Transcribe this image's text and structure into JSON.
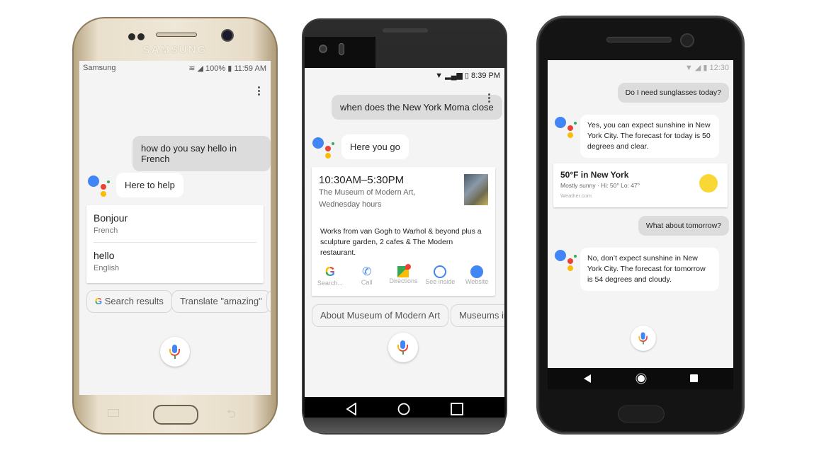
{
  "phones": [
    {
      "brand": "SAMSUNG",
      "status": {
        "carrier": "Samsung",
        "battery": "100%",
        "time": "11:59 AM"
      },
      "user_query": "how do you say hello in French",
      "assistant_reply": "Here to help",
      "translation_card": [
        {
          "word": "Bonjour",
          "language": "French"
        },
        {
          "word": "hello",
          "language": "English"
        }
      ],
      "chips": [
        {
          "icon": "google-g-icon",
          "label": "Search results"
        },
        {
          "label": "Translate \"amazing\""
        }
      ]
    },
    {
      "status": {
        "time": "8:39 PM"
      },
      "user_query": "when does the New York Moma close",
      "assistant_reply": "Here you go",
      "hours_card": {
        "hours": "10:30AM–5:30PM",
        "place": "The Museum of Modern Art,",
        "subtitle": "Wednesday hours",
        "description": "Works from van Gogh to Warhol & beyond plus a sculpture garden, 2 cafes & The Modern restaurant.",
        "actions": [
          {
            "icon": "google-g-icon",
            "label": "Search..."
          },
          {
            "icon": "phone-icon",
            "label": "Call"
          },
          {
            "icon": "maps-icon",
            "label": "Directions"
          },
          {
            "icon": "street-view-icon",
            "label": "See inside"
          },
          {
            "icon": "globe-icon",
            "label": "Website"
          }
        ]
      },
      "chips": [
        {
          "label": "About Museum of Modern Art"
        },
        {
          "label": "Museums in New York"
        }
      ]
    },
    {
      "status": {
        "time": "12:30"
      },
      "messages": [
        {
          "from": "user",
          "text": "Do I need sunglasses today?"
        },
        {
          "from": "assistant",
          "text": "Yes, you can expect sunshine in New York City. The forecast for today is 50 degrees and clear."
        },
        {
          "from": "user",
          "text": "What about tomorrow?"
        },
        {
          "from": "assistant",
          "text": "No, don’t expect sunshine in New York City. The forecast for tomorrow is 54 degrees and cloudy."
        }
      ],
      "weather_card": {
        "title": "50°F in New York",
        "detail": "Mostly sunny · Hi: 50° Lo: 47°",
        "source": "Weather.com",
        "sun_color": "#f9d835"
      }
    }
  ],
  "colors": {
    "google_blue": "#4285f4",
    "google_red": "#ea4335",
    "google_yellow": "#fbbc05",
    "google_green": "#34a853"
  }
}
